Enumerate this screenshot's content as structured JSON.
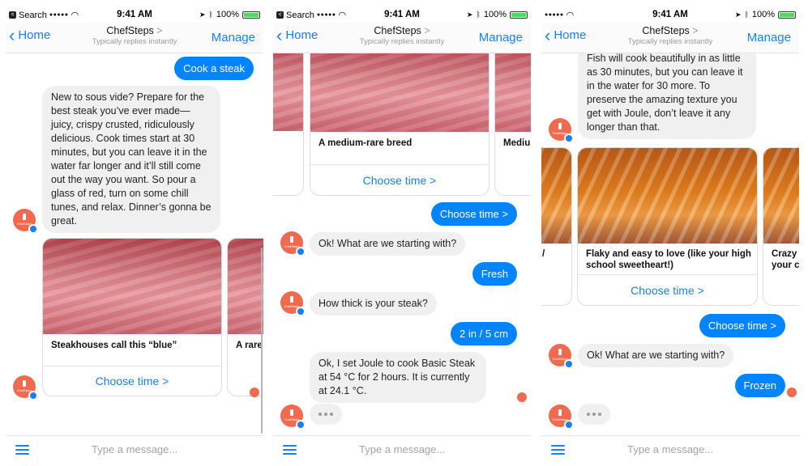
{
  "status_bar": {
    "back_app": "Search",
    "signal_dots": "●●●●●",
    "time": "9:41 AM",
    "battery": "100%",
    "battery_level": 1.0
  },
  "nav": {
    "back_label": "Home",
    "title": "ChefSteps",
    "title_arrow": ">",
    "subtitle": "Typically replies instantly",
    "right_label": "Manage"
  },
  "composer": {
    "placeholder": "Type a message..."
  },
  "avatar_text": "ChefSteps",
  "screen1": {
    "out_1": "Cook a steak",
    "in_1": "New to sous vide? Prepare for the best steak you’ve ever made—juicy, crispy crusted, ridiculously delicious. Cook times start at 30 minutes, but you can leave it in the water far longer and it’ll still come out the way you want. So pour a glass of red, turn on some chill tunes, and relax. Dinner’s gonna be great.",
    "card_1_caption": "Steakhouses call this “blue”",
    "card_1_action": "Choose time >",
    "card_2_caption": "A rare"
  },
  "screen2": {
    "card_main_caption": "A medium-rare breed",
    "card_main_action": "Choose time >",
    "card_peek_caption": "Mediu",
    "out_1": "Choose time >",
    "in_1": "Ok! What are we starting with?",
    "out_2": "Fresh",
    "in_2": "How thick is your steak?",
    "out_3": "2 in / 5 cm",
    "in_3": "Ok, I set Joule to cook Basic Steak at 54 °C for 2 hours. It is currently at 24.1 °C."
  },
  "screen3": {
    "in_1": "Fish will cook beautifully in as little as 30 minutes, but you can leave it in the water for 30 more. To preserve the amazing texture you get with Joule, don’t leave it any longer than that.",
    "card_left_caption": "/",
    "card_main_caption": "Flaky and easy to love (like your high school sweetheart!)",
    "card_main_action": "Choose time >",
    "card_peek_caption": "Crazy your c",
    "out_1": "Choose time >",
    "in_2": "Ok! What are we starting with?",
    "out_2": "Frozen"
  },
  "colors": {
    "accent": "#1a7ef5",
    "bubble_out": "#0084ff",
    "bubble_in": "#f0f0f0",
    "avatar": "#f06a50"
  }
}
